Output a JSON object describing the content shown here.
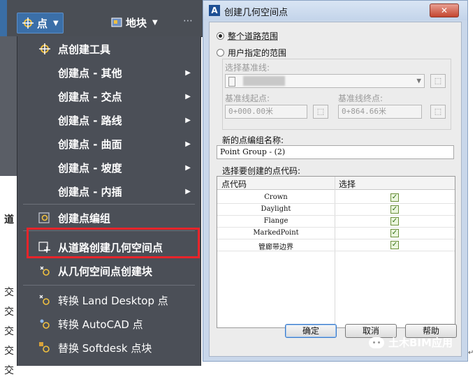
{
  "ribbon": {
    "points_label": "点",
    "surfaces_label": "地块"
  },
  "left_clipped_chars": [
    "道",
    "交",
    "交",
    "交",
    "交",
    "交"
  ],
  "menu": {
    "header": "点创建工具",
    "sub_items": [
      "创建点 - 其他",
      "创建点 - 交点",
      "创建点 - 路线",
      "创建点 - 曲面",
      "创建点 - 坡度",
      "创建点 - 内插"
    ],
    "create_point_group": "创建点编组",
    "create_from_corridor": "从道路创建几何空间点",
    "create_blocks": "从几何空间点创建块",
    "convert_ld": "转换 Land Desktop 点",
    "convert_autocad": "转换 AutoCAD 点",
    "replace_softdesk": "替换 Softdesk 点块"
  },
  "dialog": {
    "title": "创建几何空间点",
    "radio_entire": "整个道路范围",
    "radio_user": "用户指定的范围",
    "select_baseline_label": "选择基准线:",
    "baseline_start_label": "基准线起点:",
    "baseline_end_label": "基准线终点:",
    "baseline_start_value": "0+000.00米",
    "baseline_end_value": "0+864.66米",
    "group_name_label": "新的点编组名称:",
    "group_name_value": "Point Group - (2)",
    "codes_label": "选择要创建的点代码:",
    "col_code": "点代码",
    "col_select": "选择",
    "codes": [
      "Crown",
      "Daylight",
      "Flange",
      "MarkedPoint",
      "管廊带边界"
    ],
    "ok": "确定",
    "cancel": "取消",
    "help": "帮助"
  },
  "watermark": "土木BIM应用"
}
